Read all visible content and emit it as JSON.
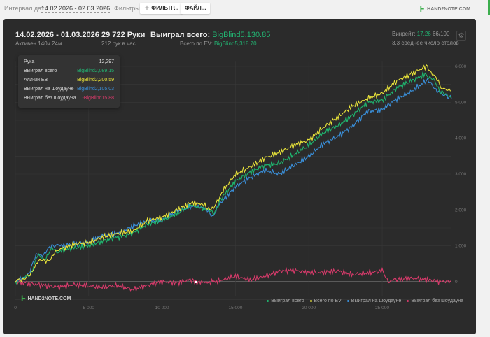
{
  "toolbar": {
    "interval_label": "Интервал дат:",
    "interval_value": "14.02.2026 - 02.03.2026",
    "filters_label": "Фильтры:",
    "filter_button": "ФИЛЬТР...",
    "file_button": "ФАЙЛ...",
    "logo": "HAND2NOTE.COM"
  },
  "summary": {
    "period": "14.02.2026 - 01.03.2026",
    "active": "Активен 140ч 24м",
    "hands": "29 722 Руки",
    "hands_per_hour": "212 рук в час",
    "won_label": "Выиграл всего:",
    "won_value": "BigBlind5,130.85",
    "ev_label": "Всего по EV:",
    "ev_value": "BigBlind5,318.70",
    "winrate_label": "Винрейт:",
    "winrate_value": "17.26",
    "winrate_extra": "66/100",
    "avg_tables": "3.3 среднее число столов"
  },
  "tooltip": {
    "rows": [
      {
        "label": "Рука",
        "value": "12,297",
        "color": "#dddddd"
      },
      {
        "label": "Выиграл всего",
        "value": "BigBlind2,089.15",
        "color": "#22b573"
      },
      {
        "label": "Алл-ин EB",
        "value": "BigBlind2,200.59",
        "color": "#e8e33a"
      },
      {
        "label": "Выиграл на шоудауне",
        "value": "BigBlind2,105.03",
        "color": "#3a8fd9"
      },
      {
        "label": "Выиграл без шоудауна",
        "value": "-BigBlind15.88",
        "color": "#d63a6a"
      }
    ]
  },
  "watermark": "HAND2NOTE.COM",
  "chart_data": {
    "type": "line",
    "xlim": [
      0,
      29722
    ],
    "ylim": [
      -400,
      6200
    ],
    "x_ticks": [
      0,
      5000,
      10000,
      15000,
      20000,
      25000
    ],
    "x_tick_labels": [
      "0",
      "5 000",
      "10 000",
      "15 000",
      "20 000",
      "25 000"
    ],
    "y_ticks": [
      0,
      1000,
      2000,
      3000,
      4000,
      5000,
      6000
    ],
    "y_tick_labels": [
      "0",
      "1 000",
      "2 000",
      "3 000",
      "4 000",
      "5 000",
      "6 000"
    ],
    "legend_position": "bottom-right",
    "series": [
      {
        "name": "Выиграл всего",
        "color": "#1fb56f",
        "points": [
          [
            0,
            0
          ],
          [
            500,
            50
          ],
          [
            1000,
            200
          ],
          [
            1500,
            700
          ],
          [
            2000,
            650
          ],
          [
            2500,
            900
          ],
          [
            3000,
            850
          ],
          [
            4000,
            950
          ],
          [
            5000,
            1000
          ],
          [
            6000,
            1150
          ],
          [
            7000,
            1250
          ],
          [
            8000,
            1350
          ],
          [
            9000,
            1600
          ],
          [
            10000,
            1700
          ],
          [
            11000,
            1900
          ],
          [
            12000,
            2150
          ],
          [
            12300,
            2089
          ],
          [
            13000,
            2000
          ],
          [
            13500,
            1900
          ],
          [
            14000,
            2300
          ],
          [
            15000,
            2800
          ],
          [
            16000,
            3050
          ],
          [
            17000,
            3250
          ],
          [
            18000,
            3300
          ],
          [
            19000,
            3550
          ],
          [
            20000,
            3800
          ],
          [
            21000,
            4150
          ],
          [
            22000,
            4350
          ],
          [
            23000,
            4650
          ],
          [
            24000,
            5000
          ],
          [
            25000,
            5050
          ],
          [
            26000,
            5400
          ],
          [
            27000,
            5600
          ],
          [
            28000,
            5800
          ],
          [
            28500,
            5600
          ],
          [
            29000,
            5300
          ],
          [
            29722,
            5131
          ]
        ]
      },
      {
        "name": "Всего по EV",
        "color": "#e8e33a",
        "points": [
          [
            0,
            0
          ],
          [
            500,
            100
          ],
          [
            1000,
            150
          ],
          [
            1500,
            600
          ],
          [
            2000,
            550
          ],
          [
            2500,
            700
          ],
          [
            3000,
            900
          ],
          [
            4000,
            1050
          ],
          [
            5000,
            1100
          ],
          [
            6000,
            1250
          ],
          [
            7000,
            1350
          ],
          [
            8000,
            1400
          ],
          [
            9000,
            1700
          ],
          [
            10000,
            1800
          ],
          [
            11000,
            2000
          ],
          [
            12000,
            2200
          ],
          [
            12300,
            2200
          ],
          [
            13000,
            2100
          ],
          [
            13500,
            2000
          ],
          [
            14000,
            2450
          ],
          [
            15000,
            3000
          ],
          [
            16000,
            3200
          ],
          [
            17000,
            3450
          ],
          [
            18000,
            3600
          ],
          [
            19000,
            3800
          ],
          [
            20000,
            3950
          ],
          [
            21000,
            4300
          ],
          [
            22000,
            4600
          ],
          [
            23000,
            4900
          ],
          [
            24000,
            5100
          ],
          [
            25000,
            5250
          ],
          [
            26000,
            5600
          ],
          [
            27000,
            5800
          ],
          [
            28000,
            6000
          ],
          [
            28500,
            5800
          ],
          [
            29000,
            5400
          ],
          [
            29722,
            5318
          ]
        ]
      },
      {
        "name": "Выиграл на шоудауне",
        "color": "#3a8fd9",
        "points": [
          [
            0,
            0
          ],
          [
            500,
            80
          ],
          [
            1000,
            300
          ],
          [
            1500,
            800
          ],
          [
            2000,
            750
          ],
          [
            2500,
            1050
          ],
          [
            3000,
            1000
          ],
          [
            4000,
            1050
          ],
          [
            5000,
            1100
          ],
          [
            6000,
            1300
          ],
          [
            7000,
            1350
          ],
          [
            8000,
            1550
          ],
          [
            9000,
            1700
          ],
          [
            10000,
            1700
          ],
          [
            11000,
            1950
          ],
          [
            12000,
            2100
          ],
          [
            12300,
            2105
          ],
          [
            13000,
            2000
          ],
          [
            13500,
            1850
          ],
          [
            14000,
            2200
          ],
          [
            15000,
            2650
          ],
          [
            16000,
            2900
          ],
          [
            17000,
            3100
          ],
          [
            18000,
            3000
          ],
          [
            19000,
            3250
          ],
          [
            20000,
            3500
          ],
          [
            21000,
            3850
          ],
          [
            22000,
            4050
          ],
          [
            23000,
            4350
          ],
          [
            24000,
            4750
          ],
          [
            25000,
            4800
          ],
          [
            26000,
            5100
          ],
          [
            27000,
            5300
          ],
          [
            28000,
            5600
          ],
          [
            28500,
            5450
          ],
          [
            29000,
            5250
          ],
          [
            29722,
            5110
          ]
        ]
      },
      {
        "name": "Выиграл без шоудауна",
        "color": "#d63a6a",
        "points": [
          [
            0,
            0
          ],
          [
            1000,
            -50
          ],
          [
            2000,
            -100
          ],
          [
            3000,
            -150
          ],
          [
            4000,
            -80
          ],
          [
            5000,
            -120
          ],
          [
            6000,
            -150
          ],
          [
            7000,
            -100
          ],
          [
            8000,
            -220
          ],
          [
            9000,
            -100
          ],
          [
            10000,
            0
          ],
          [
            11000,
            -30
          ],
          [
            12000,
            60
          ],
          [
            12300,
            -16
          ],
          [
            13000,
            -30
          ],
          [
            14000,
            40
          ],
          [
            15000,
            150
          ],
          [
            16000,
            50
          ],
          [
            17000,
            150
          ],
          [
            18000,
            300
          ],
          [
            19000,
            320
          ],
          [
            20000,
            250
          ],
          [
            21000,
            260
          ],
          [
            22000,
            300
          ],
          [
            23000,
            200
          ],
          [
            24000,
            250
          ],
          [
            25000,
            300
          ],
          [
            25500,
            0
          ],
          [
            26000,
            50
          ],
          [
            27000,
            100
          ],
          [
            28000,
            60
          ],
          [
            29000,
            0
          ],
          [
            29722,
            20
          ]
        ]
      }
    ]
  }
}
